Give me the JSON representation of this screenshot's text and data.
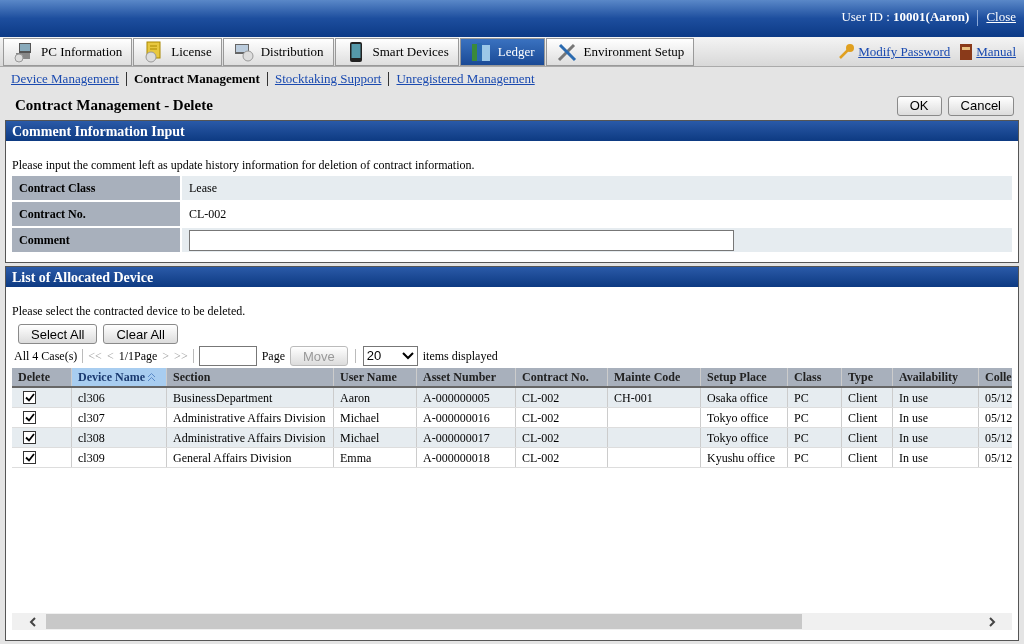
{
  "header": {
    "user_label": "User ID : ",
    "user_id": "10001(Aaron)",
    "close": "Close"
  },
  "tabs": [
    {
      "label": "PC Information",
      "selected": false
    },
    {
      "label": "License",
      "selected": false
    },
    {
      "label": "Distribution",
      "selected": false
    },
    {
      "label": "Smart Devices",
      "selected": false
    },
    {
      "label": "Ledger",
      "selected": true
    },
    {
      "label": "Environment Setup",
      "selected": false
    }
  ],
  "header_links": [
    {
      "label": "Modify Password"
    },
    {
      "label": "Manual"
    }
  ],
  "subnav": [
    {
      "label": "Device Management",
      "selected": false
    },
    {
      "label": "Contract Management",
      "selected": true
    },
    {
      "label": "Stocktaking Support",
      "selected": false
    },
    {
      "label": "Unregistered Management",
      "selected": false
    }
  ],
  "page_title": "Contract Management - Delete",
  "actions": [
    "OK",
    "Cancel"
  ],
  "comment_section": {
    "title": "Comment Information Input",
    "note": "Please input the comment left as update history information for deletion of contract information.",
    "fields": [
      {
        "label": "Contract Class",
        "kind": "text",
        "value": "Lease"
      },
      {
        "label": "Contract No.",
        "kind": "text",
        "value": "CL-002"
      },
      {
        "label": "Comment",
        "kind": "input"
      }
    ]
  },
  "device_section": {
    "title": "List of Allocated Device",
    "note": "Please select the contracted device to be deleted.",
    "buttons": [
      "Select All",
      "Clear All"
    ],
    "pager": {
      "count": "All 4 Case(s)",
      "first": "<<",
      "prev": "<",
      "page": "1/1Page",
      "next": ">",
      "last": ">>",
      "page_label": "Page",
      "move": "Move",
      "per_page": "20",
      "per_page_label": "items displayed"
    },
    "table": {
      "columns": [
        {
          "label": "Delete",
          "sorted": false
        },
        {
          "label": "Device Name",
          "sorted": true
        },
        {
          "label": "Section",
          "sorted": false
        },
        {
          "label": "User Name",
          "sorted": false
        },
        {
          "label": "Asset Number",
          "sorted": false
        },
        {
          "label": "Contract No.",
          "sorted": false
        },
        {
          "label": "Mainte Code",
          "sorted": false
        },
        {
          "label": "Setup Place",
          "sorted": false
        },
        {
          "label": "Class",
          "sorted": false
        },
        {
          "label": "Type",
          "sorted": false
        },
        {
          "label": "Availability",
          "sorted": false
        },
        {
          "label": "Colle",
          "sorted": false
        }
      ],
      "rows": [
        {
          "checked": true,
          "cells": [
            "",
            "cl306",
            "BusinessDepartment",
            "Aaron",
            "A-000000005",
            "CL-002",
            "CH-001",
            "Osaka office",
            "PC",
            "Client",
            "In use",
            "05/12"
          ]
        },
        {
          "checked": true,
          "cells": [
            "",
            "cl307",
            "Administrative Affairs Division",
            "Michael",
            "A-000000016",
            "CL-002",
            "",
            "Tokyo office",
            "PC",
            "Client",
            "In use",
            "05/12"
          ]
        },
        {
          "checked": true,
          "cells": [
            "",
            "cl308",
            "Administrative Affairs Division",
            "Michael",
            "A-000000017",
            "CL-002",
            "",
            "Tokyo office",
            "PC",
            "Client",
            "In use",
            "05/12"
          ]
        },
        {
          "checked": true,
          "cells": [
            "",
            "cl309",
            "General Affairs Division",
            "Emma",
            "A-000000018",
            "CL-002",
            "",
            "Kyushu office",
            "PC",
            "Client",
            "In use",
            "05/12"
          ]
        }
      ]
    }
  }
}
